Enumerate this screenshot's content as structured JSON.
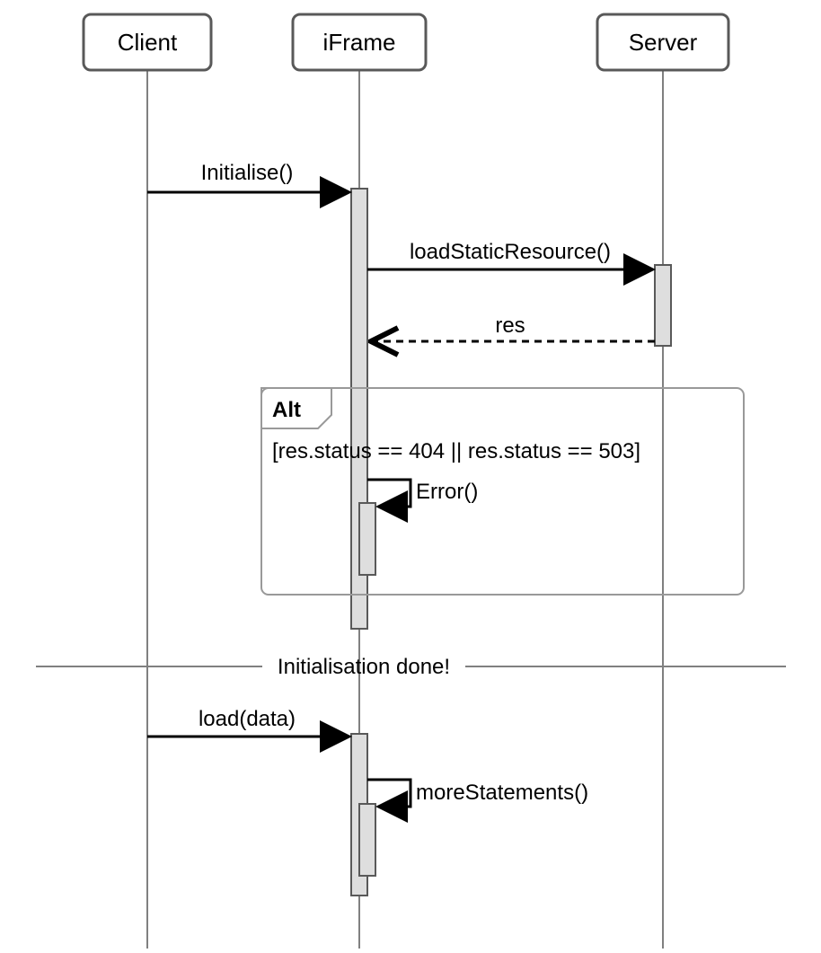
{
  "participants": {
    "client": "Client",
    "iframe": "iFrame",
    "server": "Server"
  },
  "messages": {
    "initialise": "Initialise()",
    "loadStaticResource": "loadStaticResource()",
    "res": "res",
    "error": "Error()",
    "load": "load(data)",
    "moreStatements": "moreStatements()"
  },
  "fragment": {
    "label": "Alt",
    "guard": "[res.status == 404 || res.status == 503]"
  },
  "divider": "Initialisation done!",
  "chart_data": {
    "type": "sequence-diagram",
    "participants": [
      "Client",
      "iFrame",
      "Server"
    ],
    "events": [
      {
        "type": "message",
        "from": "Client",
        "to": "iFrame",
        "label": "Initialise()",
        "style": "solid"
      },
      {
        "type": "activation-start",
        "on": "iFrame"
      },
      {
        "type": "message",
        "from": "iFrame",
        "to": "Server",
        "label": "loadStaticResource()",
        "style": "solid"
      },
      {
        "type": "activation-start",
        "on": "Server"
      },
      {
        "type": "message",
        "from": "Server",
        "to": "iFrame",
        "label": "res",
        "style": "dashed"
      },
      {
        "type": "activation-end",
        "on": "Server"
      },
      {
        "type": "fragment-start",
        "kind": "Alt",
        "guard": "[res.status == 404 || res.status == 503]"
      },
      {
        "type": "self-message",
        "on": "iFrame",
        "label": "Error()",
        "style": "solid"
      },
      {
        "type": "fragment-end"
      },
      {
        "type": "activation-end",
        "on": "iFrame"
      },
      {
        "type": "divider",
        "label": "Initialisation done!"
      },
      {
        "type": "message",
        "from": "Client",
        "to": "iFrame",
        "label": "load(data)",
        "style": "solid"
      },
      {
        "type": "activation-start",
        "on": "iFrame"
      },
      {
        "type": "self-message",
        "on": "iFrame",
        "label": "moreStatements()",
        "style": "solid"
      },
      {
        "type": "activation-end",
        "on": "iFrame"
      }
    ]
  }
}
